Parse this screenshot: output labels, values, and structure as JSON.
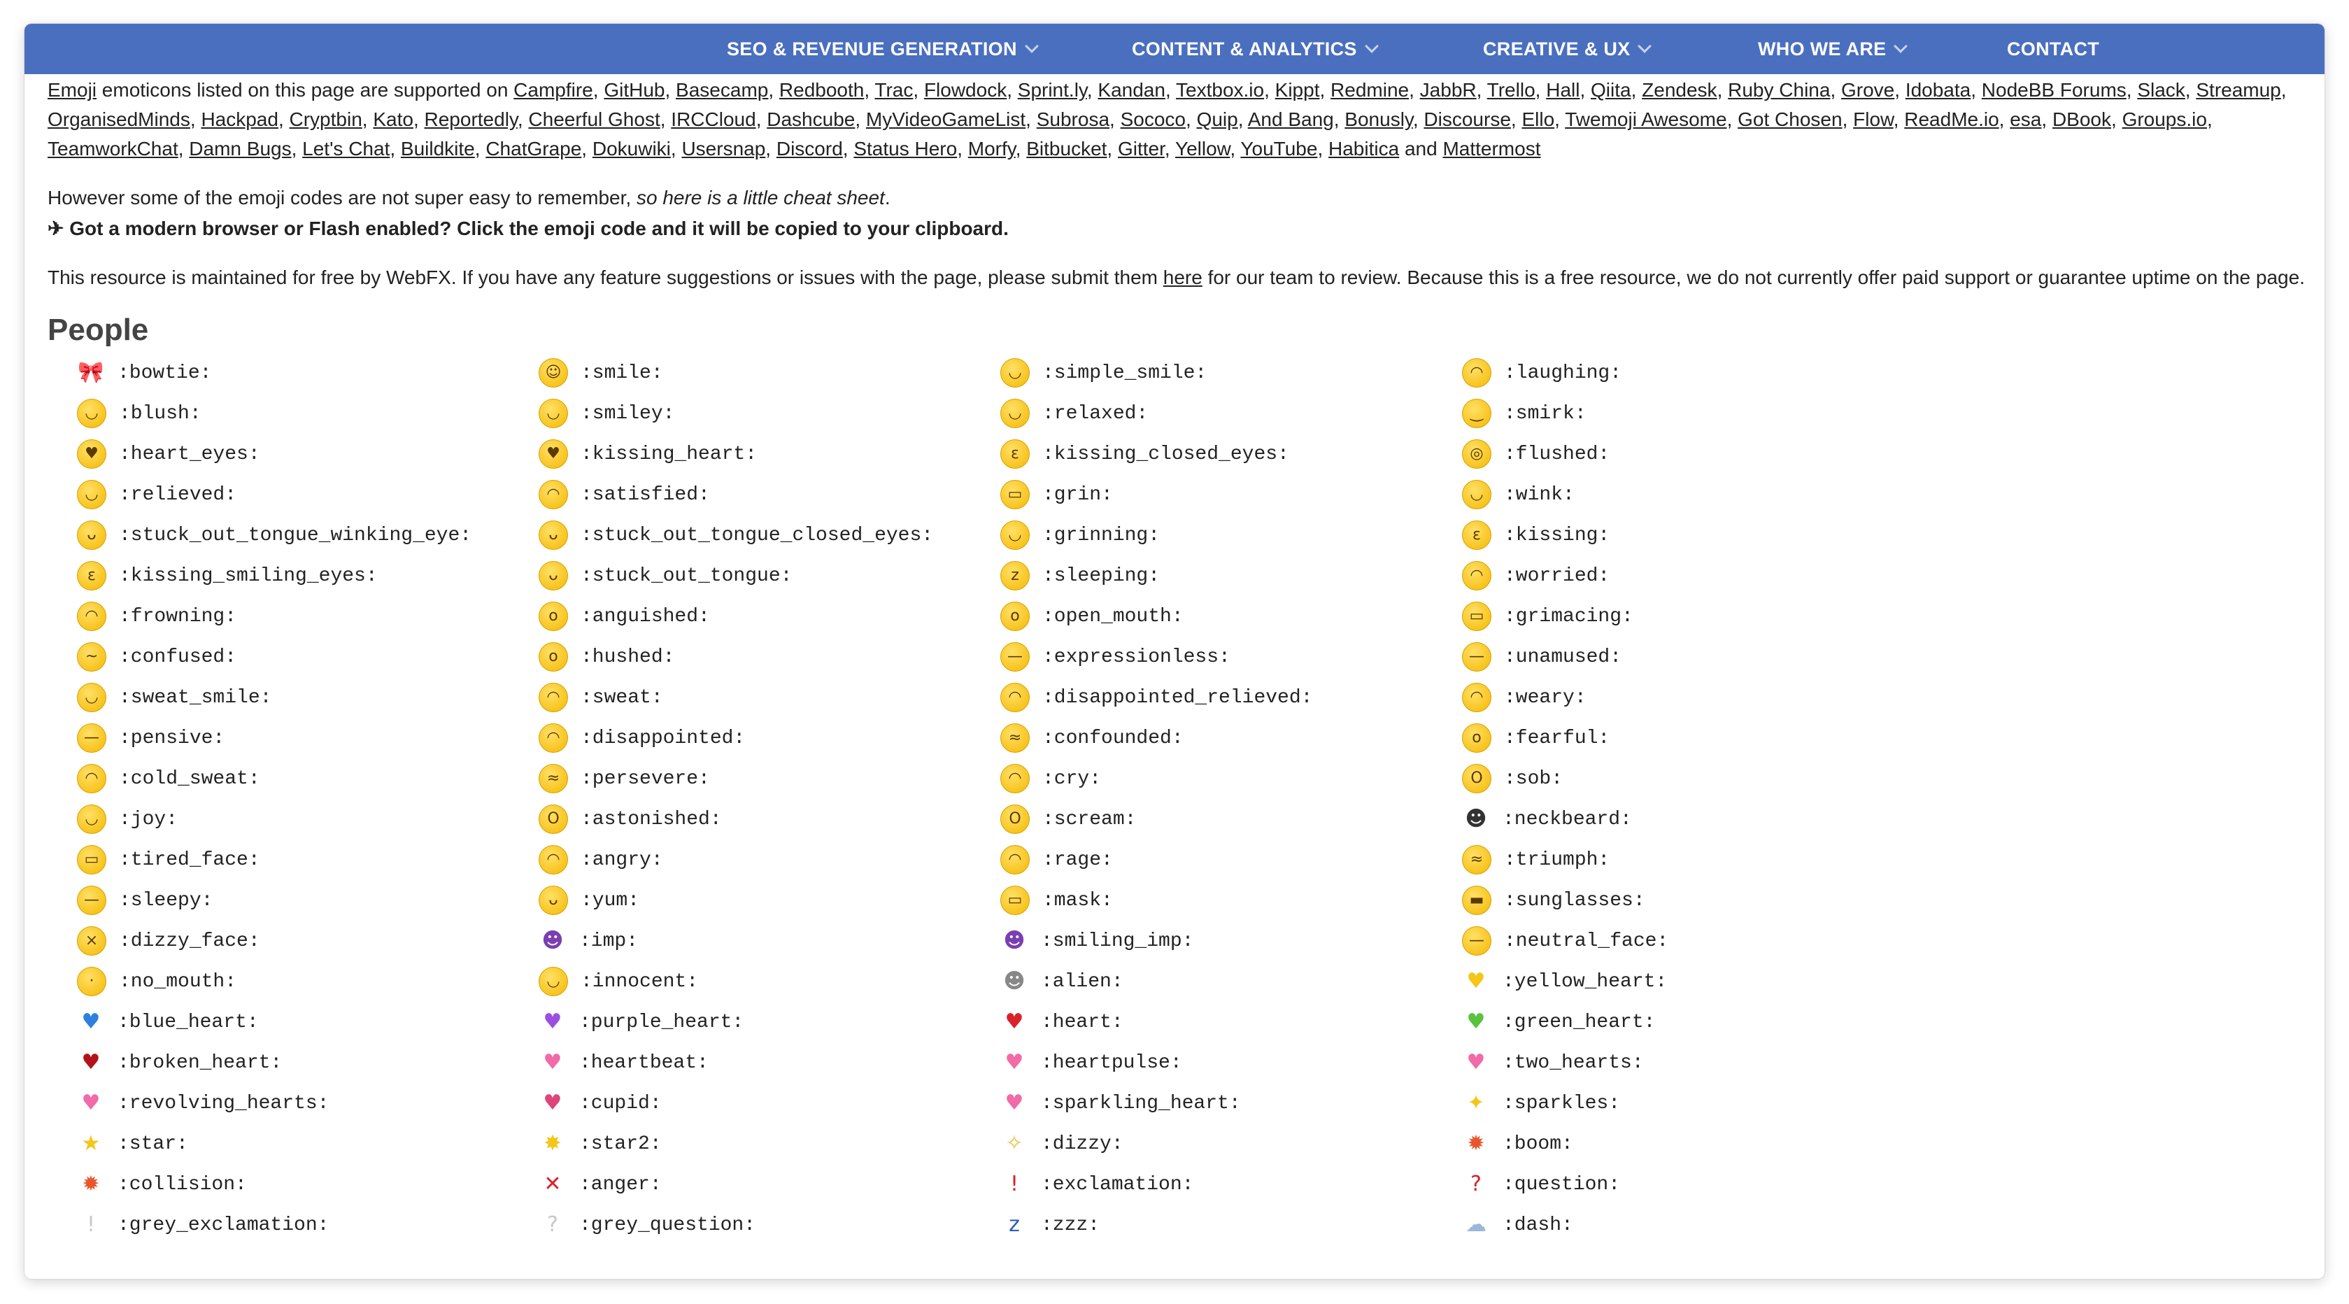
{
  "nav": {
    "items": [
      {
        "label": "SEO & REVENUE GENERATION",
        "dropdown": true
      },
      {
        "label": "CONTENT & ANALYTICS",
        "dropdown": true
      },
      {
        "label": "CREATIVE & UX",
        "dropdown": true
      },
      {
        "label": "WHO WE ARE",
        "dropdown": true
      },
      {
        "label": "CONTACT",
        "dropdown": false
      }
    ],
    "bg_color": "#4a6fbf"
  },
  "intro": {
    "lead_link": "Emoji",
    "lead_text": " emoticons listed on this page are supported on ",
    "services": [
      "Campfire",
      "GitHub",
      "Basecamp",
      "Redbooth",
      "Trac",
      "Flowdock",
      "Sprint.ly",
      "Kandan",
      "Textbox.io",
      "Kippt",
      "Redmine",
      "JabbR",
      "Trello",
      "Hall",
      "Qiita",
      "Zendesk",
      "Ruby China",
      "Grove",
      "Idobata",
      "NodeBB Forums",
      "Slack",
      "Streamup",
      "OrganisedMinds",
      "Hackpad",
      "Cryptbin",
      "Kato",
      "Reportedly",
      "Cheerful Ghost",
      "IRCCloud",
      "Dashcube",
      "MyVideoGameList",
      "Subrosa",
      "Sococo",
      "Quip",
      "And Bang",
      "Bonusly",
      "Discourse",
      "Ello",
      "Twemoji Awesome",
      "Got Chosen",
      "Flow",
      "ReadMe.io",
      "esa",
      "DBook",
      "Groups.io",
      "TeamworkChat",
      "Damn Bugs",
      "Let's Chat",
      "Buildkite",
      "ChatGrape",
      "Dokuwiki",
      "Usersnap",
      "Discord",
      "Status Hero",
      "Morfy",
      "Bitbucket",
      "Gitter",
      "Yellow",
      "YouTube",
      "Habitica"
    ],
    "and_word": "and",
    "last_service": "Mattermost"
  },
  "cheat": {
    "text": "However some of the emoji codes are not super easy to remember, ",
    "emphasis": "so here is a little cheat sheet",
    "end": "."
  },
  "clipboard_note": "✈ Got a modern browser or Flash enabled? Click the emoji code and it will be copied to your clipboard.",
  "maintained": {
    "before": "This resource is maintained for free by WebFX. If you have any feature suggestions or issues with the page, please submit them ",
    "link": "here",
    "after": " for our team to review. Because this is a free resource, we do not currently offer paid support or guarantee uptime on the page."
  },
  "section_title": "People",
  "emojis": [
    {
      "code": ":bowtie:",
      "glyph": "🎀",
      "style": "plain",
      "icon": "bowtie-icon"
    },
    {
      "code": ":smile:",
      "glyph": "☺",
      "style": "face",
      "icon": "smile-icon"
    },
    {
      "code": ":simple_smile:",
      "glyph": "◡",
      "style": "face",
      "icon": "simple-smile-icon"
    },
    {
      "code": ":laughing:",
      "glyph": "◠",
      "style": "face",
      "icon": "laughing-icon"
    },
    {
      "code": ":blush:",
      "glyph": "◡",
      "style": "face",
      "icon": "blush-icon"
    },
    {
      "code": ":smiley:",
      "glyph": "◡",
      "style": "face",
      "icon": "smiley-icon"
    },
    {
      "code": ":relaxed:",
      "glyph": "◡",
      "style": "face",
      "icon": "relaxed-icon"
    },
    {
      "code": ":smirk:",
      "glyph": "‿",
      "style": "face",
      "icon": "smirk-icon"
    },
    {
      "code": ":heart_eyes:",
      "glyph": "♥",
      "style": "face",
      "icon": "heart-eyes-icon"
    },
    {
      "code": ":kissing_heart:",
      "glyph": "♥",
      "style": "face",
      "icon": "kissing-heart-icon"
    },
    {
      "code": ":kissing_closed_eyes:",
      "glyph": "ε",
      "style": "face",
      "icon": "kissing-closed-eyes-icon"
    },
    {
      "code": ":flushed:",
      "glyph": "◎",
      "style": "face",
      "icon": "flushed-icon"
    },
    {
      "code": ":relieved:",
      "glyph": "◡",
      "style": "face",
      "icon": "relieved-icon"
    },
    {
      "code": ":satisfied:",
      "glyph": "◠",
      "style": "face",
      "icon": "satisfied-icon"
    },
    {
      "code": ":grin:",
      "glyph": "▭",
      "style": "face",
      "icon": "grin-icon"
    },
    {
      "code": ":wink:",
      "glyph": "◡",
      "style": "face",
      "icon": "wink-icon"
    },
    {
      "code": ":stuck_out_tongue_winking_eye:",
      "glyph": "ᴗ",
      "style": "face",
      "icon": "tongue-winking-icon"
    },
    {
      "code": ":stuck_out_tongue_closed_eyes:",
      "glyph": "ᴗ",
      "style": "face",
      "icon": "tongue-closed-eyes-icon"
    },
    {
      "code": ":grinning:",
      "glyph": "◡",
      "style": "face",
      "icon": "grinning-icon"
    },
    {
      "code": ":kissing:",
      "glyph": "ε",
      "style": "face",
      "icon": "kissing-icon"
    },
    {
      "code": ":kissing_smiling_eyes:",
      "glyph": "ε",
      "style": "face",
      "icon": "kissing-smiling-eyes-icon"
    },
    {
      "code": ":stuck_out_tongue:",
      "glyph": "ᴗ",
      "style": "face",
      "icon": "stuck-out-tongue-icon"
    },
    {
      "code": ":sleeping:",
      "glyph": "z",
      "style": "face",
      "icon": "sleeping-icon"
    },
    {
      "code": ":worried:",
      "glyph": "◠",
      "style": "face",
      "icon": "worried-icon"
    },
    {
      "code": ":frowning:",
      "glyph": "◠",
      "style": "face",
      "icon": "frowning-icon"
    },
    {
      "code": ":anguished:",
      "glyph": "o",
      "style": "face",
      "icon": "anguished-icon"
    },
    {
      "code": ":open_mouth:",
      "glyph": "o",
      "style": "face",
      "icon": "open-mouth-icon"
    },
    {
      "code": ":grimacing:",
      "glyph": "▭",
      "style": "face",
      "icon": "grimacing-icon"
    },
    {
      "code": ":confused:",
      "glyph": "~",
      "style": "face",
      "icon": "confused-icon"
    },
    {
      "code": ":hushed:",
      "glyph": "o",
      "style": "face",
      "icon": "hushed-icon"
    },
    {
      "code": ":expressionless:",
      "glyph": "—",
      "style": "face",
      "icon": "expressionless-icon"
    },
    {
      "code": ":unamused:",
      "glyph": "—",
      "style": "face",
      "icon": "unamused-icon"
    },
    {
      "code": ":sweat_smile:",
      "glyph": "◡",
      "style": "face",
      "icon": "sweat-smile-icon"
    },
    {
      "code": ":sweat:",
      "glyph": "◠",
      "style": "face",
      "icon": "sweat-icon"
    },
    {
      "code": ":disappointed_relieved:",
      "glyph": "◠",
      "style": "face",
      "icon": "disappointed-relieved-icon"
    },
    {
      "code": ":weary:",
      "glyph": "◠",
      "style": "face",
      "icon": "weary-icon"
    },
    {
      "code": ":pensive:",
      "glyph": "—",
      "style": "face",
      "icon": "pensive-icon"
    },
    {
      "code": ":disappointed:",
      "glyph": "◠",
      "style": "face",
      "icon": "disappointed-icon"
    },
    {
      "code": ":confounded:",
      "glyph": "≈",
      "style": "face",
      "icon": "confounded-icon"
    },
    {
      "code": ":fearful:",
      "glyph": "o",
      "style": "face",
      "icon": "fearful-icon"
    },
    {
      "code": ":cold_sweat:",
      "glyph": "◠",
      "style": "face",
      "icon": "cold-sweat-icon"
    },
    {
      "code": ":persevere:",
      "glyph": "≈",
      "style": "face",
      "icon": "persevere-icon"
    },
    {
      "code": ":cry:",
      "glyph": "◠",
      "style": "face",
      "icon": "cry-icon"
    },
    {
      "code": ":sob:",
      "glyph": "O",
      "style": "face",
      "icon": "sob-icon"
    },
    {
      "code": ":joy:",
      "glyph": "◡",
      "style": "face",
      "icon": "joy-icon"
    },
    {
      "code": ":astonished:",
      "glyph": "O",
      "style": "face",
      "icon": "astonished-icon"
    },
    {
      "code": ":scream:",
      "glyph": "O",
      "style": "face",
      "icon": "scream-icon"
    },
    {
      "code": ":neckbeard:",
      "glyph": "☻",
      "style": "plain",
      "icon": "neckbeard-icon"
    },
    {
      "code": ":tired_face:",
      "glyph": "▭",
      "style": "face",
      "icon": "tired-face-icon"
    },
    {
      "code": ":angry:",
      "glyph": "◠",
      "style": "face",
      "icon": "angry-icon"
    },
    {
      "code": ":rage:",
      "glyph": "◠",
      "style": "face",
      "icon": "rage-icon"
    },
    {
      "code": ":triumph:",
      "glyph": "≈",
      "style": "face",
      "icon": "triumph-icon"
    },
    {
      "code": ":sleepy:",
      "glyph": "—",
      "style": "face",
      "icon": "sleepy-icon"
    },
    {
      "code": ":yum:",
      "glyph": "ᴗ",
      "style": "face",
      "icon": "yum-icon"
    },
    {
      "code": ":mask:",
      "glyph": "▭",
      "style": "face",
      "icon": "mask-icon"
    },
    {
      "code": ":sunglasses:",
      "glyph": "▬",
      "style": "face",
      "icon": "sunglasses-icon"
    },
    {
      "code": ":dizzy_face:",
      "glyph": "×",
      "style": "face",
      "icon": "dizzy-face-icon"
    },
    {
      "code": ":imp:",
      "glyph": "☻",
      "style": "plain",
      "icon": "imp-icon"
    },
    {
      "code": ":smiling_imp:",
      "glyph": "☻",
      "style": "plain",
      "icon": "smiling-imp-icon"
    },
    {
      "code": ":neutral_face:",
      "glyph": "—",
      "style": "face",
      "icon": "neutral-face-icon"
    },
    {
      "code": ":no_mouth:",
      "glyph": "·",
      "style": "face",
      "icon": "no-mouth-icon"
    },
    {
      "code": ":innocent:",
      "glyph": "◡",
      "style": "face",
      "icon": "innocent-icon"
    },
    {
      "code": ":alien:",
      "glyph": "☻",
      "style": "plain",
      "icon": "alien-icon"
    },
    {
      "code": ":yellow_heart:",
      "glyph": "♥",
      "style": "plain",
      "icon": "yellow-heart-icon"
    },
    {
      "code": ":blue_heart:",
      "glyph": "♥",
      "style": "plain",
      "icon": "blue-heart-icon"
    },
    {
      "code": ":purple_heart:",
      "glyph": "♥",
      "style": "plain",
      "icon": "purple-heart-icon"
    },
    {
      "code": ":heart:",
      "glyph": "♥",
      "style": "plain",
      "icon": "heart-icon"
    },
    {
      "code": ":green_heart:",
      "glyph": "♥",
      "style": "plain",
      "icon": "green-heart-icon"
    },
    {
      "code": ":broken_heart:",
      "glyph": "♥",
      "style": "plain",
      "icon": "broken-heart-icon"
    },
    {
      "code": ":heartbeat:",
      "glyph": "♥",
      "style": "plain",
      "icon": "heartbeat-icon"
    },
    {
      "code": ":heartpulse:",
      "glyph": "♥",
      "style": "plain",
      "icon": "heartpulse-icon"
    },
    {
      "code": ":two_hearts:",
      "glyph": "♥",
      "style": "plain",
      "icon": "two-hearts-icon"
    },
    {
      "code": ":revolving_hearts:",
      "glyph": "♥",
      "style": "plain",
      "icon": "revolving-hearts-icon"
    },
    {
      "code": ":cupid:",
      "glyph": "♥",
      "style": "plain",
      "icon": "cupid-icon"
    },
    {
      "code": ":sparkling_heart:",
      "glyph": "♥",
      "style": "plain",
      "icon": "sparkling-heart-icon"
    },
    {
      "code": ":sparkles:",
      "glyph": "✦",
      "style": "plain",
      "icon": "sparkles-icon"
    },
    {
      "code": ":star:",
      "glyph": "★",
      "style": "plain",
      "icon": "star-icon"
    },
    {
      "code": ":star2:",
      "glyph": "✸",
      "style": "plain",
      "icon": "star2-icon"
    },
    {
      "code": ":dizzy:",
      "glyph": "✧",
      "style": "plain",
      "icon": "dizzy-icon"
    },
    {
      "code": ":boom:",
      "glyph": "✹",
      "style": "plain",
      "icon": "boom-icon"
    },
    {
      "code": ":collision:",
      "glyph": "✹",
      "style": "plain",
      "icon": "collision-icon"
    },
    {
      "code": ":anger:",
      "glyph": "✕",
      "style": "plain",
      "icon": "anger-icon"
    },
    {
      "code": ":exclamation:",
      "glyph": "!",
      "style": "plain",
      "icon": "exclamation-icon"
    },
    {
      "code": ":question:",
      "glyph": "?",
      "style": "plain",
      "icon": "question-icon"
    },
    {
      "code": ":grey_exclamation:",
      "glyph": "!",
      "style": "plain",
      "icon": "grey-exclamation-icon"
    },
    {
      "code": ":grey_question:",
      "glyph": "?",
      "style": "plain",
      "icon": "grey-question-icon"
    },
    {
      "code": ":zzz:",
      "glyph": "z",
      "style": "plain",
      "icon": "zzz-icon"
    },
    {
      "code": ":dash:",
      "glyph": "☁",
      "style": "plain",
      "icon": "dash-icon"
    }
  ],
  "glyph_colors": {
    "heart-icon": "#d8232a",
    "blue-heart-icon": "#2f7fe0",
    "purple-heart-icon": "#9b4fe0",
    "green-heart-icon": "#5ac23c",
    "yellow-heart-icon": "#f5c518",
    "broken-heart-icon": "#b3121b",
    "heartbeat-icon": "#f06ba8",
    "heartpulse-icon": "#f06ba8",
    "two-hearts-icon": "#f06ba8",
    "revolving-hearts-icon": "#f06ba8",
    "cupid-icon": "#e0447a",
    "sparkling-heart-icon": "#f06ba8",
    "sparkles-icon": "#f5c518",
    "star-icon": "#f5c518",
    "star2-icon": "#f5c518",
    "dizzy-icon": "#e8c13a",
    "boom-icon": "#e8562a",
    "collision-icon": "#e8562a",
    "anger-icon": "#d8232a",
    "exclamation-icon": "#d8232a",
    "question-icon": "#d8232a",
    "grey-exclamation-icon": "#c8c8c8",
    "grey-question-icon": "#c8c8c8",
    "zzz-icon": "#2f5fb0",
    "dash-icon": "#9bb8d8",
    "imp-icon": "#7a3fb0",
    "smiling-imp-icon": "#7a3fb0",
    "alien-icon": "#888888",
    "neckbeard-icon": "#333333",
    "bowtie-icon": "#a0522d"
  }
}
